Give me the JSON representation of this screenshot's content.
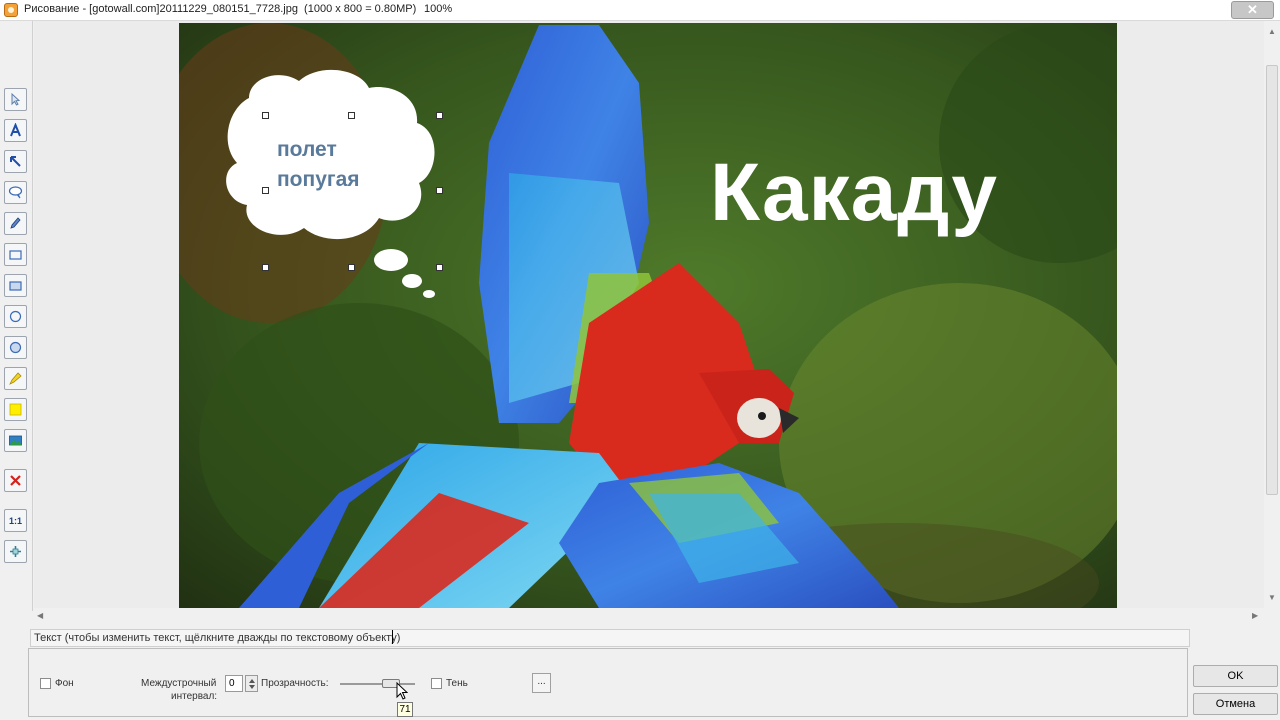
{
  "window": {
    "title": "Рисование - [gotowall.com]20111229_080151_7728.jpg  (1000 x 800 = 0.80MP)",
    "zoom": "100%",
    "close_glyph": "✕"
  },
  "toolbar": {
    "tools": [
      {
        "name": "select-tool",
        "icon": "pointer-icon"
      },
      {
        "name": "text-tool",
        "icon": "text-a-icon"
      },
      {
        "name": "arrow-tool",
        "icon": "arrow-icon"
      },
      {
        "name": "callout-tool",
        "icon": "speech-bubble-icon"
      },
      {
        "name": "pen-tool",
        "icon": "pencil-icon"
      },
      {
        "name": "rectangle-tool",
        "icon": "rectangle-outline-icon"
      },
      {
        "name": "filled-rectangle-tool",
        "icon": "rectangle-filled-icon"
      },
      {
        "name": "ellipse-tool",
        "icon": "ellipse-outline-icon"
      },
      {
        "name": "filled-ellipse-tool",
        "icon": "ellipse-filled-icon"
      },
      {
        "name": "highlighter-tool",
        "icon": "highlighter-icon"
      },
      {
        "name": "color-tool",
        "icon": "color-swatch-icon"
      },
      {
        "name": "image-tool",
        "icon": "image-icon"
      },
      {
        "name": "delete-tool",
        "icon": "red-x-icon"
      },
      {
        "name": "actual-size-tool",
        "icon": "one-to-one-icon",
        "label": "1:1"
      },
      {
        "name": "fit-tool",
        "icon": "fit-arrows-icon"
      }
    ]
  },
  "canvas": {
    "bubble_text_line1": "полет",
    "bubble_text_line2": "попугая",
    "caption": "Какаду",
    "caption_color": "#ffffff",
    "bubble_text_color": "#5a7a9b"
  },
  "status": {
    "text": "Текст (чтобы изменить текст, щёлкните дважды по текстовому объекту)"
  },
  "panel": {
    "background_label": "Фон",
    "line_spacing_label_line1": "Междустрочный",
    "line_spacing_label_line2": "интервал:",
    "line_spacing_value": "0",
    "transparency_label": "Прозрачность:",
    "transparency_value": "71",
    "shadow_label": "Тень",
    "more_button_label": "...",
    "ok_label": "OK",
    "cancel_label": "Отмена"
  }
}
